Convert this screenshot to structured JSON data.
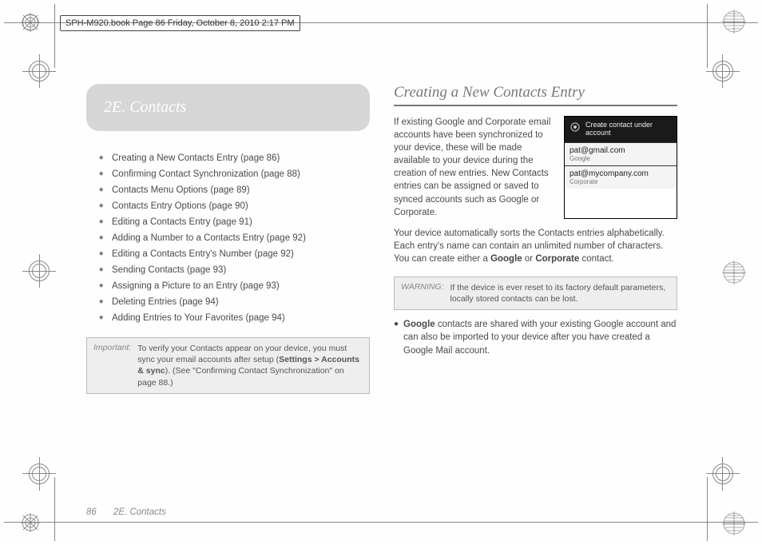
{
  "header_strip": "SPH-M920.book  Page 86  Friday, October 8, 2010  2:17 PM",
  "section_number": "2E.",
  "section_name": "Contacts",
  "section_title_full": "2E.  Contacts",
  "toc": [
    "Creating a New Contacts Entry (page 86)",
    "Confirming Contact Synchronization (page 88)",
    "Contacts Menu Options (page 89)",
    "Contacts Entry Options (page 90)",
    "Editing a Contacts Entry (page 91)",
    "Adding a Number to a Contacts Entry (page 92)",
    "Editing a Contacts Entry's Number (page 92)",
    "Sending Contacts (page 93)",
    "Assigning a Picture to an Entry (page 93)",
    "Deleting Entries (page 94)",
    "Adding Entries to Your Favorites (page 94)"
  ],
  "important_label": "Important:",
  "important_body_pre": "To verify your Contacts appear on your device, you must sync your email accounts after setup (",
  "important_body_bold": "Settings > Accounts & sync",
  "important_body_post": "). (See \"Confirming Contact Synchronization\" on page 88.)",
  "h2": "Creating a New Contacts Entry",
  "intro": "If existing Google and Corporate email accounts have been synchronized to your device, these will be made available to your device during the creation of new entries. New Contacts entries can be assigned or saved to synced accounts such as Google or Corporate.",
  "shot": {
    "title_line1": "Create contact under",
    "title_line2": "account",
    "rows": [
      {
        "acct": "pat@gmail.com",
        "type": "Google"
      },
      {
        "acct": "pat@mycompany.com",
        "type": "Corporate"
      }
    ]
  },
  "para2_pre": "Your device automatically sorts the Contacts entries alphabetically. Each entry's name can contain an unlimited number of characters. You can create either a ",
  "para2_b1": "Google",
  "para2_mid": " or ",
  "para2_b2": "Corporate",
  "para2_post": " contact.",
  "warning_label": "WARNING:",
  "warning_body": "If the device is ever reset to its factory default parameters, locally stored contacts can be lost.",
  "bullet_b": "Google",
  "bullet_rest": " contacts are shared with your existing Google account and can also be imported to your device after you have created a Google Mail account.",
  "footer_page": "86",
  "footer_chapter": "2E. Contacts"
}
